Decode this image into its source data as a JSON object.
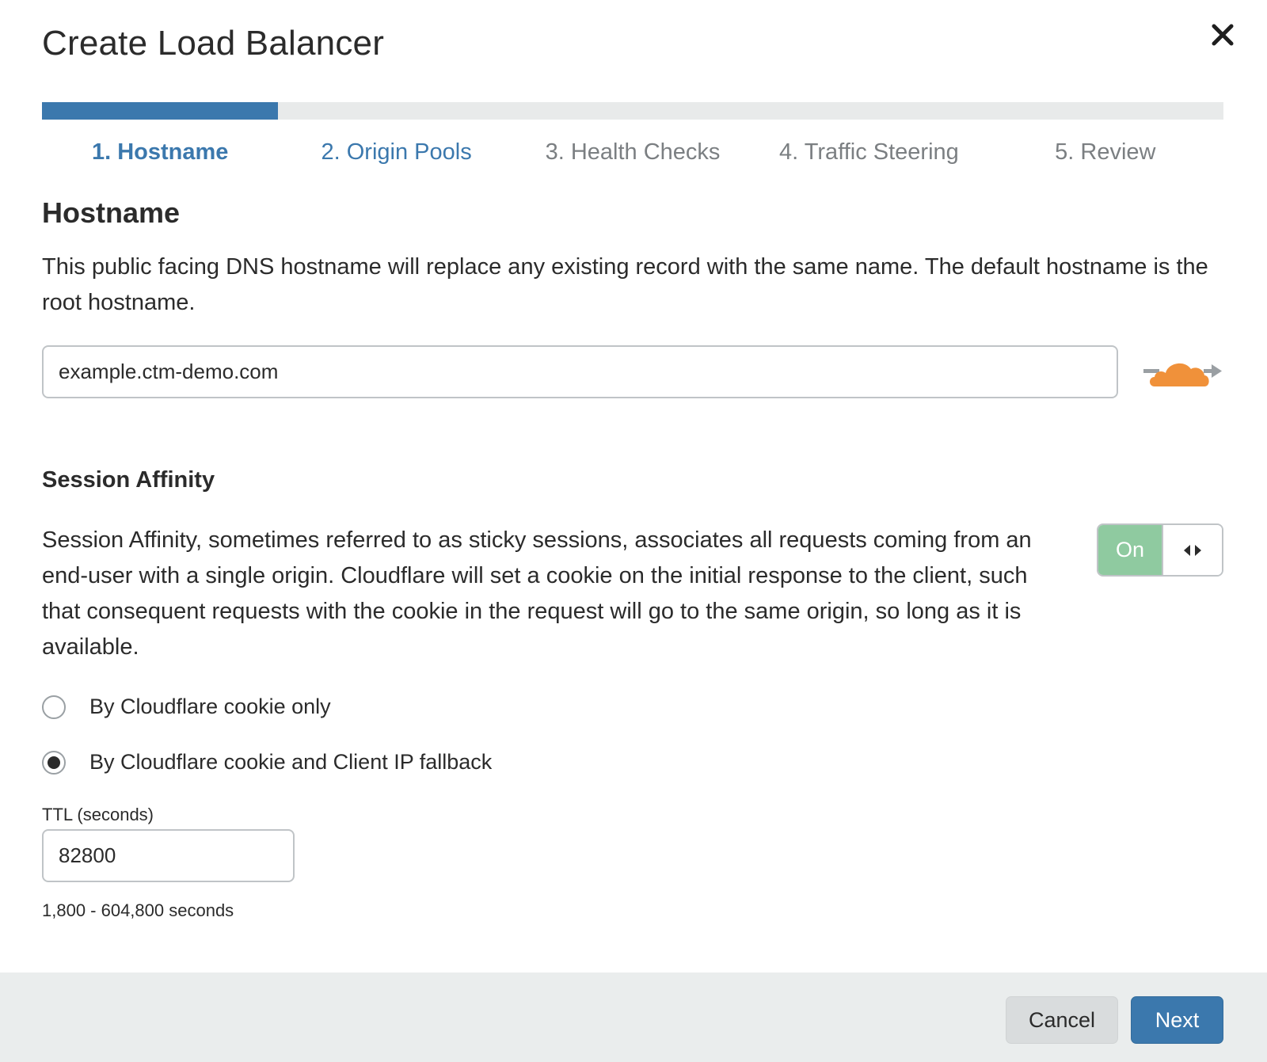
{
  "modal": {
    "title": "Create Load Balancer",
    "close_icon": "close-icon"
  },
  "wizard": {
    "progress_fraction": 0.2,
    "steps": [
      {
        "label": "1. Hostname",
        "state": "active"
      },
      {
        "label": "2. Origin Pools",
        "state": "link"
      },
      {
        "label": "3. Health Checks",
        "state": "inactive"
      },
      {
        "label": "4. Traffic Steering",
        "state": "inactive"
      },
      {
        "label": "5. Review",
        "state": "inactive"
      }
    ]
  },
  "hostname": {
    "heading": "Hostname",
    "description": "This public facing DNS hostname will replace any existing record with the same name. The default hostname is the root hostname.",
    "input_value": "example.ctm-demo.com",
    "proxy_icon": "cloud-proxy-icon"
  },
  "session_affinity": {
    "heading": "Session Affinity",
    "description": "Session Affinity, sometimes referred to as sticky sessions, associates all requests coming from an end-user with a single origin. Cloudflare will set a cookie on the initial response to the client, such that consequent requests with the cookie in the request will go to the same origin, so long as it is available.",
    "toggle_label": "On",
    "toggle_icon": "code-arrows-icon",
    "options": [
      {
        "label": "By Cloudflare cookie only",
        "selected": false
      },
      {
        "label": "By Cloudflare cookie and Client IP fallback",
        "selected": true
      }
    ],
    "ttl_label": "TTL (seconds)",
    "ttl_value": "82800",
    "ttl_hint": "1,800 - 604,800 seconds"
  },
  "footer": {
    "cancel_label": "Cancel",
    "next_label": "Next"
  },
  "colors": {
    "primary": "#3b78ad",
    "toggle_on": "#8fcaa0",
    "cloud_orange": "#f0913a",
    "footer_bg": "#eaeded"
  }
}
